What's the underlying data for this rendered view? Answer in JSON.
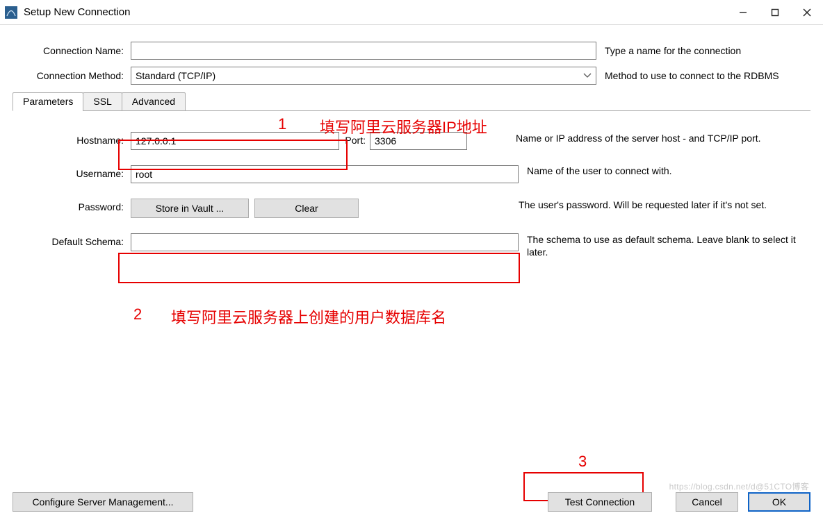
{
  "window": {
    "title": "Setup New Connection"
  },
  "form": {
    "connection_name": {
      "label": "Connection Name:",
      "value": "",
      "hint": "Type a name for the connection"
    },
    "connection_method": {
      "label": "Connection Method:",
      "value": "Standard (TCP/IP)",
      "hint": "Method to use to connect to the RDBMS"
    }
  },
  "tabs": {
    "parameters": "Parameters",
    "ssl": "SSL",
    "advanced": "Advanced"
  },
  "params": {
    "hostname": {
      "label": "Hostname:",
      "value": "127.0.0.1",
      "port_label": "Port:",
      "port_value": "3306",
      "hint": "Name or IP address of the server host - and TCP/IP port."
    },
    "username": {
      "label": "Username:",
      "value": "root",
      "hint": "Name of the user to connect with."
    },
    "password": {
      "label": "Password:",
      "store_btn": "Store in Vault ...",
      "clear_btn": "Clear",
      "hint": "The user's password. Will be requested later if it's not set."
    },
    "default_schema": {
      "label": "Default Schema:",
      "value": "",
      "hint": "The schema to use as default schema. Leave blank to select it later."
    }
  },
  "annotations": {
    "a1_num": "1",
    "a1_text": "填写阿里云服务器IP地址",
    "a2_num": "2",
    "a2_text": "填写阿里云服务器上创建的用户数据库名",
    "a3_num": "3"
  },
  "footer": {
    "configure": "Configure Server Management...",
    "test": "Test Connection",
    "cancel": "Cancel",
    "ok": "OK"
  },
  "watermark": "https://blog.csdn.net/d@51CTO博客"
}
